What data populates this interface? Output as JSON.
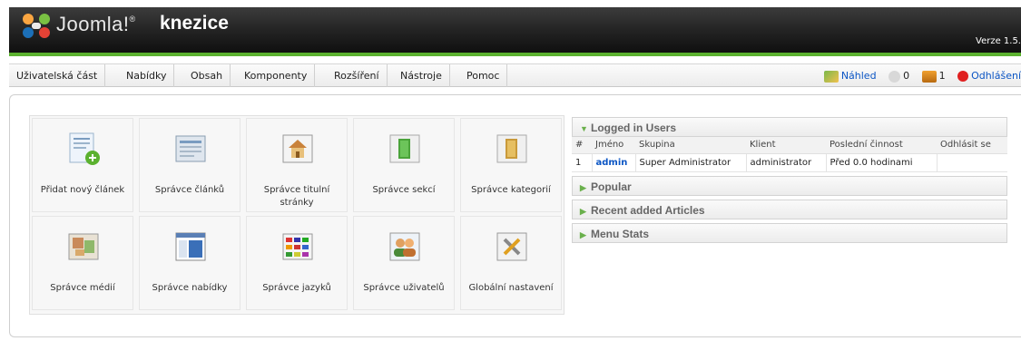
{
  "header": {
    "brand": "Joomla!",
    "site_name": "knezice",
    "version": "Verze 1.5."
  },
  "menu": {
    "items": [
      {
        "label": "Uživatelská část"
      },
      {
        "label": "Nabídky"
      },
      {
        "label": "Obsah"
      },
      {
        "label": "Komponenty"
      },
      {
        "label": "Rozšíření"
      },
      {
        "label": "Nástroje"
      },
      {
        "label": "Pomoc"
      }
    ]
  },
  "status": {
    "preview": "Náhled",
    "messages_count": "0",
    "users_count": "1",
    "logout": "Odhlášení"
  },
  "cpanel": {
    "tiles": [
      {
        "label": "Přidat nový článek",
        "icon": "add-article-icon"
      },
      {
        "label": "Správce článků",
        "icon": "article-manager-icon"
      },
      {
        "label": "Správce titulní stránky",
        "icon": "frontpage-manager-icon"
      },
      {
        "label": "Správce sekcí",
        "icon": "section-manager-icon"
      },
      {
        "label": "Správce kategorií",
        "icon": "category-manager-icon"
      },
      {
        "label": "Správce médií",
        "icon": "media-manager-icon"
      },
      {
        "label": "Správce nabídky",
        "icon": "menu-manager-icon"
      },
      {
        "label": "Správce jazyků",
        "icon": "language-manager-icon"
      },
      {
        "label": "Správce uživatelů",
        "icon": "user-manager-icon"
      },
      {
        "label": "Globální nastavení",
        "icon": "global-config-icon"
      }
    ]
  },
  "panes": {
    "logged_in": {
      "title": "Logged in Users",
      "columns": [
        "#",
        "Jméno",
        "Skupina",
        "Klient",
        "Poslední činnost",
        "Odhlásit se"
      ],
      "rows": [
        {
          "num": "1",
          "name": "admin",
          "group": "Super Administrator",
          "client": "administrator",
          "last": "Před 0.0 hodinami",
          "logout": ""
        }
      ]
    },
    "popular": {
      "title": "Popular"
    },
    "recent": {
      "title": "Recent added Articles"
    },
    "menu_stats": {
      "title": "Menu Stats"
    }
  },
  "colors": {
    "accent_green": "#5bb12f",
    "link_blue": "#0b55c4",
    "header_dark": "#1a1a1a"
  }
}
